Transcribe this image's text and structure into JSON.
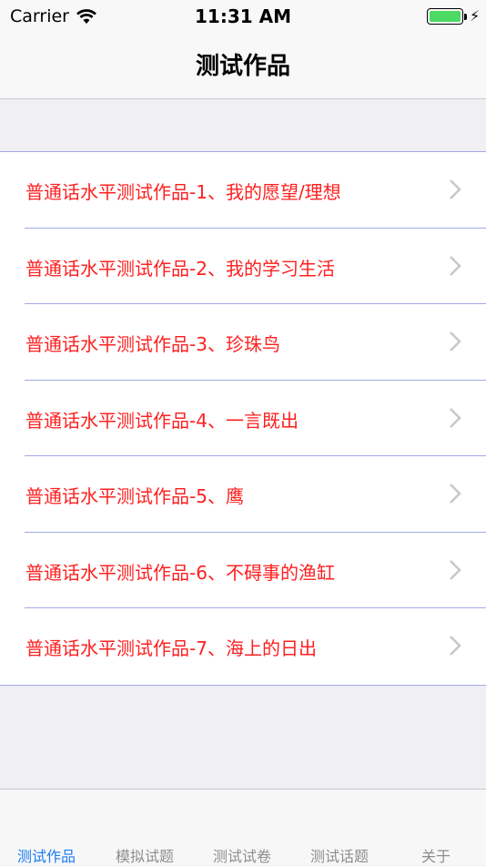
{
  "status_bar": {
    "carrier": "Carrier",
    "time": "11:31 AM",
    "battery_level": 1.0,
    "battery_color": "#4cd964",
    "charging_icon": "bolt-icon"
  },
  "nav": {
    "title": "测试作品"
  },
  "list": {
    "items": [
      "普通话水平测试作品-1、我的愿望/理想",
      "普通话水平测试作品-2、我的学习生活",
      "普通话水平测试作品-3、珍珠鸟",
      "普通话水平测试作品-4、一言既出",
      "普通话水平测试作品-5、鹰",
      "普通话水平测试作品-6、不碍事的渔缸",
      "普通话水平测试作品-7、海上的日出"
    ],
    "label_color": "#ff2020",
    "chevron_icon": "chevron-right-icon"
  },
  "tab_bar": {
    "tabs": [
      "测试作品",
      "模拟试题",
      "测试试卷",
      "测试话题",
      "关于"
    ],
    "active_index": 0,
    "active_color": "#1a7cf5"
  }
}
